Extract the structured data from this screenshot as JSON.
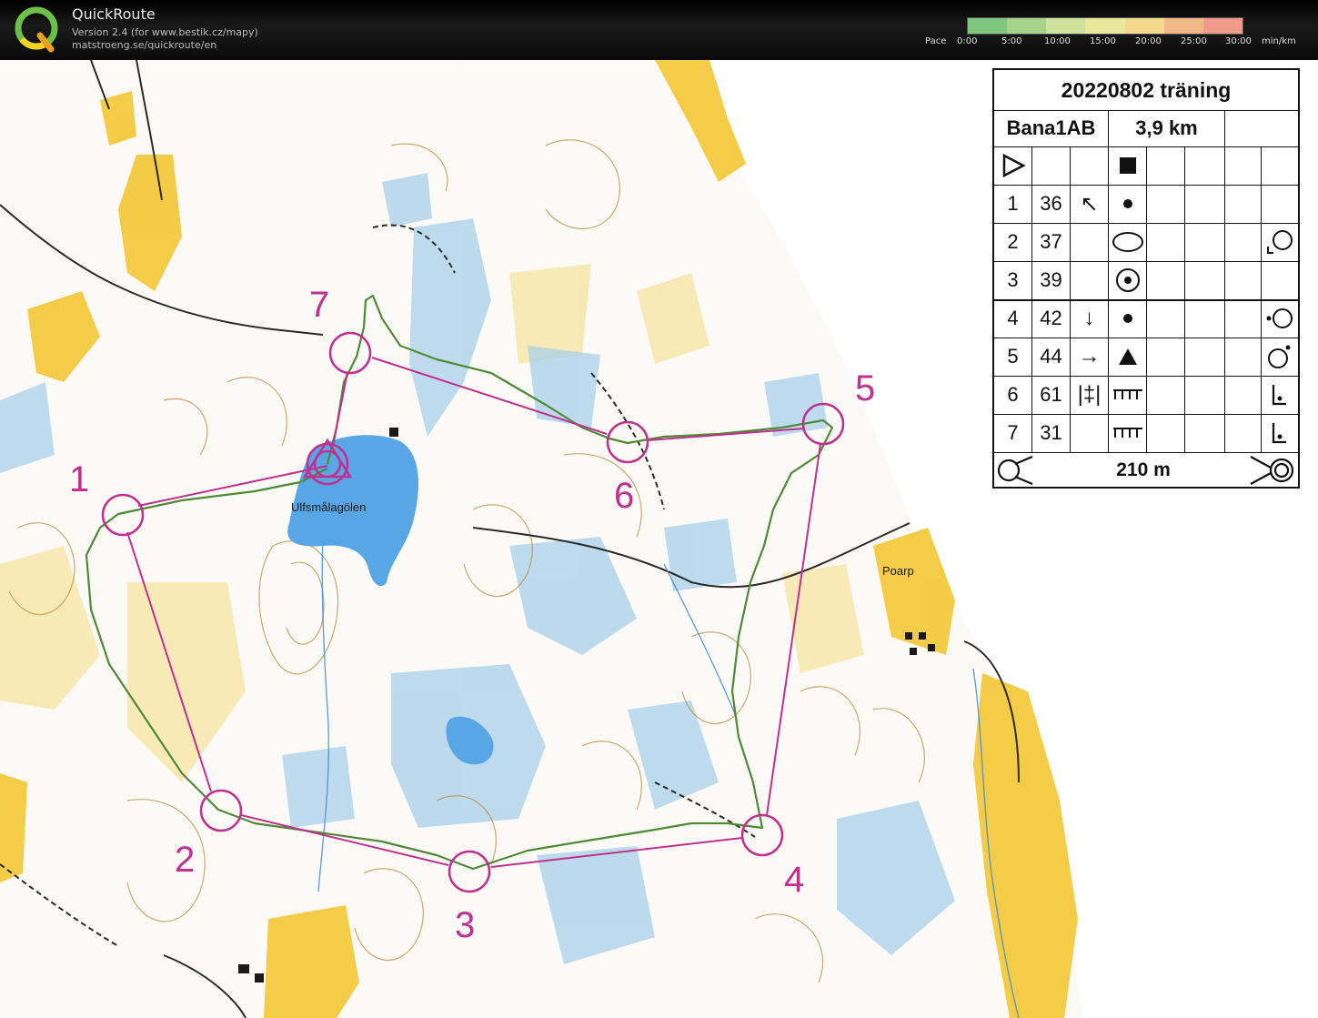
{
  "app": {
    "title": "QuickRoute",
    "version": "Version 2.4  (for www.bestik.cz/mapy)",
    "url": "matstroeng.se/quickroute/en"
  },
  "pace_legend": {
    "label": "Pace",
    "unit": "min/km",
    "ticks": [
      "0:00",
      "5:00",
      "10:00",
      "15:00",
      "20:00",
      "25:00",
      "30:00"
    ],
    "colors": [
      "#7fc77f",
      "#a6d38a",
      "#cde29a",
      "#e9e69d",
      "#f4d98f",
      "#f2b787",
      "#ef9a8a"
    ]
  },
  "map": {
    "colors": {
      "course": "#c0308f",
      "route": "#4f8a35",
      "water": "#58a6e6",
      "marsh": "#a9d0e9",
      "open_land": "#f3c733",
      "contour": "#b8862e"
    },
    "labels": {
      "lake": "Ulfsmålagölen",
      "farm": "Poarp"
    },
    "control_numbers": [
      "1",
      "2",
      "3",
      "4",
      "5",
      "6",
      "7"
    ]
  },
  "description_sheet": {
    "title": "20220802 träning",
    "course": "Bana1AB",
    "length": "3,9 km",
    "controls": [
      {
        "num": "1",
        "code": "36"
      },
      {
        "num": "2",
        "code": "37"
      },
      {
        "num": "3",
        "code": "39"
      },
      {
        "num": "4",
        "code": "42"
      },
      {
        "num": "5",
        "code": "44"
      },
      {
        "num": "6",
        "code": "61"
      },
      {
        "num": "7",
        "code": "31"
      }
    ],
    "finish_distance": "210 m"
  }
}
